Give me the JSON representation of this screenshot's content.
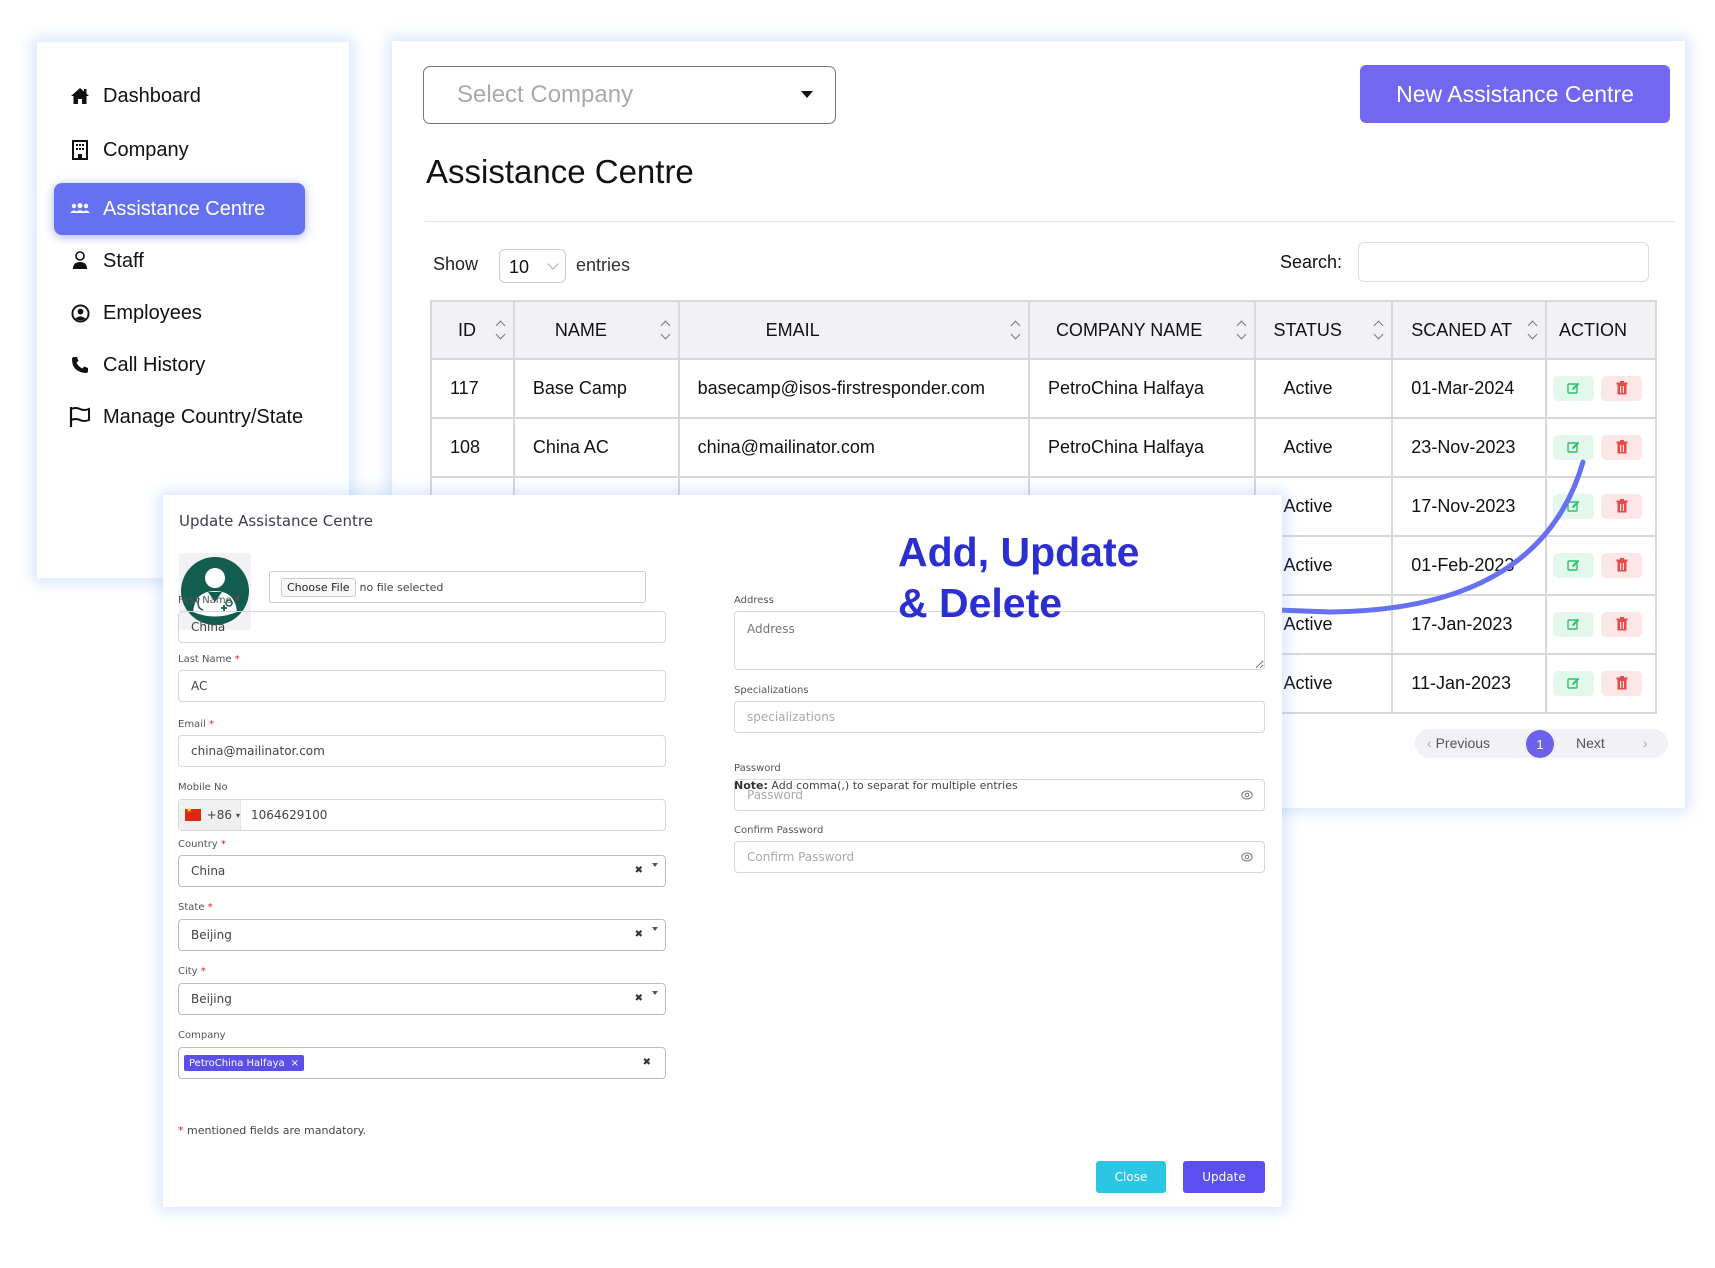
{
  "sidebar": {
    "items": [
      {
        "label": "Dashboard",
        "icon": "home-icon"
      },
      {
        "label": "Company",
        "icon": "building-icon"
      },
      {
        "label": "Assistance Centre",
        "icon": "users-icon",
        "active": true
      },
      {
        "label": "Staff",
        "icon": "staff-icon"
      },
      {
        "label": "Employees",
        "icon": "user-circle-icon"
      },
      {
        "label": "Call History",
        "icon": "phone-icon"
      },
      {
        "label": "Manage Country/State",
        "icon": "flag-icon"
      }
    ]
  },
  "main": {
    "company_select_placeholder": "Select Company",
    "new_button": "New Assistance Centre",
    "title": "Assistance Centre",
    "show_label": "Show",
    "entries_value": "10",
    "entries_label": "entries",
    "search_label": "Search:",
    "search_value": "",
    "table": {
      "columns": [
        "ID",
        "NAME",
        "EMAIL",
        "COMPANY NAME",
        "STATUS",
        "SCANED AT",
        "ACTION"
      ],
      "rows": [
        {
          "id": "117",
          "name": "Base Camp",
          "email": "basecamp@isos-firstresponder.com",
          "company": "PetroChina Halfaya",
          "status": "Active",
          "scanned_at": "01-Mar-2024"
        },
        {
          "id": "108",
          "name": "China AC",
          "email": "china@mailinator.com",
          "company": "PetroChina Halfaya",
          "status": "Active",
          "scanned_at": "23-Nov-2023"
        },
        {
          "id": "",
          "name": "",
          "email": "",
          "company": "",
          "status": "Active",
          "scanned_at": "17-Nov-2023"
        },
        {
          "id": "",
          "name": "",
          "email": "",
          "company": "",
          "status": "Active",
          "scanned_at": "01-Feb-2023"
        },
        {
          "id": "",
          "name": "",
          "email": "",
          "company": "",
          "status": "Active",
          "scanned_at": "17-Jan-2023"
        },
        {
          "id": "",
          "name": "",
          "email": "",
          "company": "",
          "status": "Active",
          "scanned_at": "11-Jan-2023"
        }
      ]
    },
    "pagination": {
      "previous": "Previous",
      "current_page": "1",
      "next": "Next"
    }
  },
  "modal": {
    "title": "Update Assistance Centre",
    "file_button": "Choose File",
    "file_status": "no file selected",
    "fields": {
      "first_name": {
        "label": "First Name",
        "required": "*",
        "value": "China"
      },
      "last_name": {
        "label": "Last Name",
        "required": "*",
        "value": "AC"
      },
      "email": {
        "label": "Email",
        "required": "*",
        "value": "china@mailinator.com"
      },
      "mobile": {
        "label": "Mobile No",
        "dial_code": "+86",
        "value": "1064629100"
      },
      "country": {
        "label": "Country",
        "required": "*",
        "value": "China"
      },
      "state": {
        "label": "State",
        "required": "*",
        "value": "Beijing"
      },
      "city": {
        "label": "City",
        "required": "*",
        "value": "Beijing"
      },
      "company": {
        "label": "Company",
        "tag": "PetroChina Halfaya"
      },
      "address": {
        "label": "Address",
        "placeholder": "Address"
      },
      "specializations": {
        "label": "Specializations",
        "placeholder": "specializations"
      },
      "password": {
        "label": "Password",
        "placeholder": "Password"
      },
      "confirm_password": {
        "label": "Confirm Password",
        "placeholder": "Confirm Password"
      }
    },
    "note_bold": "Note:",
    "note_text": " Add comma(,) to separat for multiple entries",
    "mandatory_star": "*",
    "mandatory_text": " mentioned fields are mandatory.",
    "close_button": "Close",
    "update_button": "Update"
  },
  "annotation": {
    "line1": "Add, Update",
    "line2": "& Delete",
    "color": "#2c2fcf",
    "arrow_color": "#6571f1"
  },
  "colors": {
    "accent": "#6571f1",
    "primary_button": "#7367ef",
    "status_active": "#3ccf7e",
    "delete": "#e84a4a",
    "edit": "#2fbf6a"
  }
}
